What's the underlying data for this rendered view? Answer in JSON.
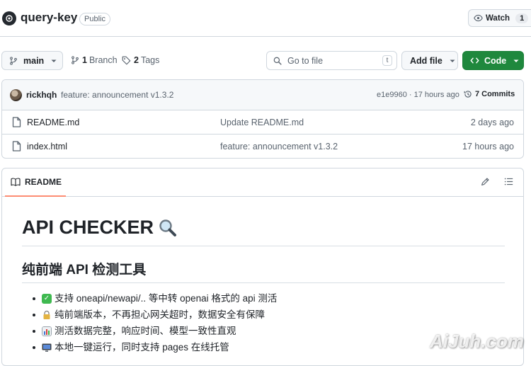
{
  "repo": {
    "name": "query-key",
    "visibility": "Public",
    "watch_label": "Watch",
    "watch_count": "1"
  },
  "toolbar": {
    "branch": "main",
    "branch_count": "1",
    "branch_label": "Branch",
    "tag_count": "2",
    "tag_label": "Tags",
    "goto_placeholder": "Go to file",
    "goto_shortcut": "t",
    "add_file_label": "Add file",
    "code_label": "Code"
  },
  "commit": {
    "author": "rickhqh",
    "message": "feature: announcement v1.3.2",
    "hash_time": "e1e9960 · 17 hours ago",
    "commits_count": "7",
    "commits_label": "Commits"
  },
  "files": [
    {
      "name": "README.md",
      "message": "Update README.md",
      "time": "2 days ago"
    },
    {
      "name": "index.html",
      "message": "feature: announcement v1.3.2",
      "time": "17 hours ago"
    }
  ],
  "readme": {
    "tab_label": "README",
    "title": "API CHECKER",
    "title_emoji": "🔍",
    "subtitle": "纯前端 API 检测工具",
    "features": [
      {
        "icon": "check-mark-icon",
        "text": "支持 oneapi/newapi/.. 等中转 openai 格式的 api 测活"
      },
      {
        "icon": "lock-icon",
        "text": "纯前端版本，不再担心网关超时，数据安全有保障"
      },
      {
        "icon": "bar-chart-icon",
        "text": "测活数据完整，响应时间、模型一致性直观"
      },
      {
        "icon": "monitor-icon",
        "text": "本地一键运行，同时支持 pages 在线托管"
      }
    ]
  },
  "watermark": "AiJuh.com",
  "colors": {
    "code_button": "#1f883d",
    "tab_underline": "#fd8c73",
    "border": "#d0d7de"
  }
}
